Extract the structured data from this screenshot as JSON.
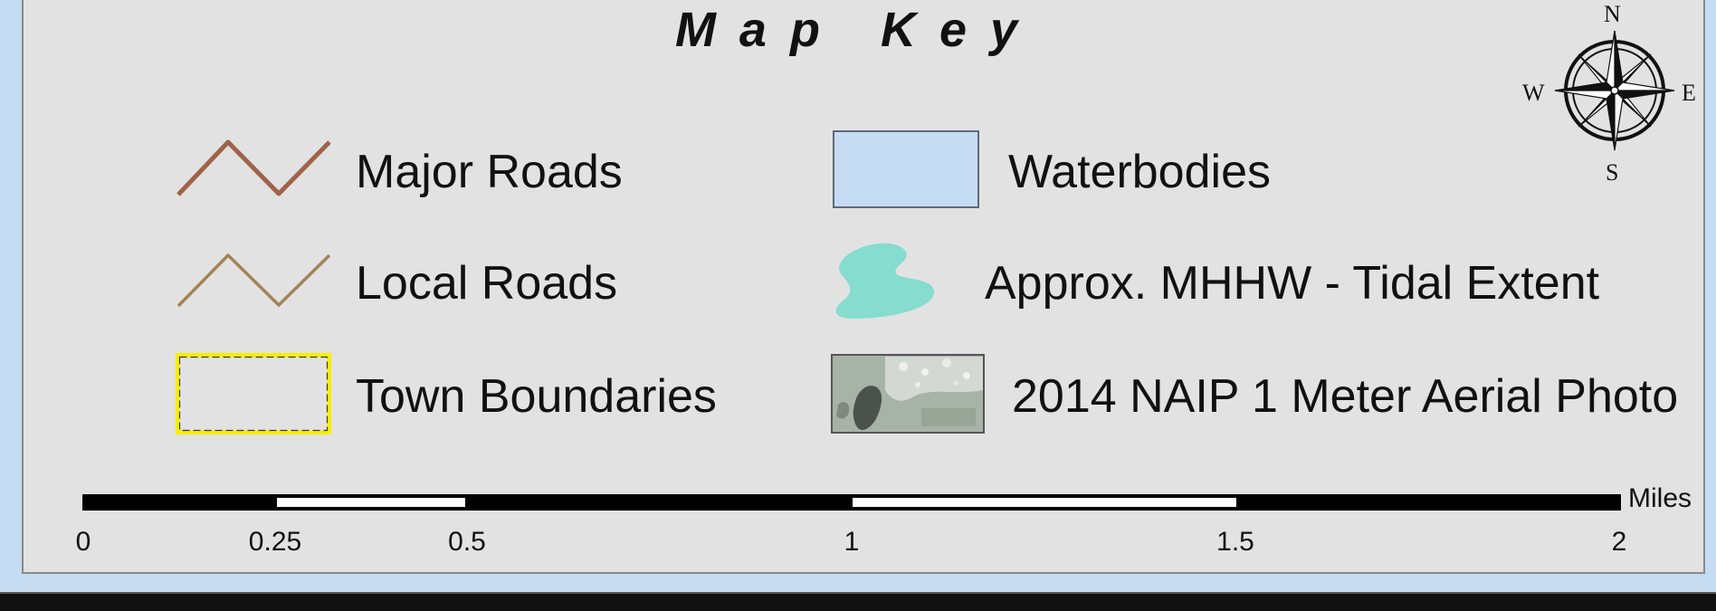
{
  "title": "Map Key",
  "legend": {
    "items": [
      {
        "label": "Major Roads",
        "symbol": "major-road-line",
        "color": "#a0634a"
      },
      {
        "label": "Local Roads",
        "symbol": "local-road-line",
        "color": "#a38258"
      },
      {
        "label": "Town Boundaries",
        "symbol": "town-boundary-box",
        "color": "#f5f000"
      },
      {
        "label": "Waterbodies",
        "symbol": "waterbody-box",
        "color": "#c5dcf3"
      },
      {
        "label": "Approx. MHHW - Tidal Extent",
        "symbol": "tidal-extent-blob",
        "color": "#85dccf"
      },
      {
        "label": "2014 NAIP 1 Meter Aerial Photo",
        "symbol": "aerial-photo-swatch",
        "color": "#9aa89a"
      }
    ]
  },
  "scale_bar": {
    "unit": "Miles",
    "ticks": [
      "0",
      "0.25",
      "0.5",
      "1",
      "1.5",
      "2"
    ]
  },
  "compass": {
    "n": "N",
    "s": "S",
    "e": "E",
    "w": "W"
  }
}
